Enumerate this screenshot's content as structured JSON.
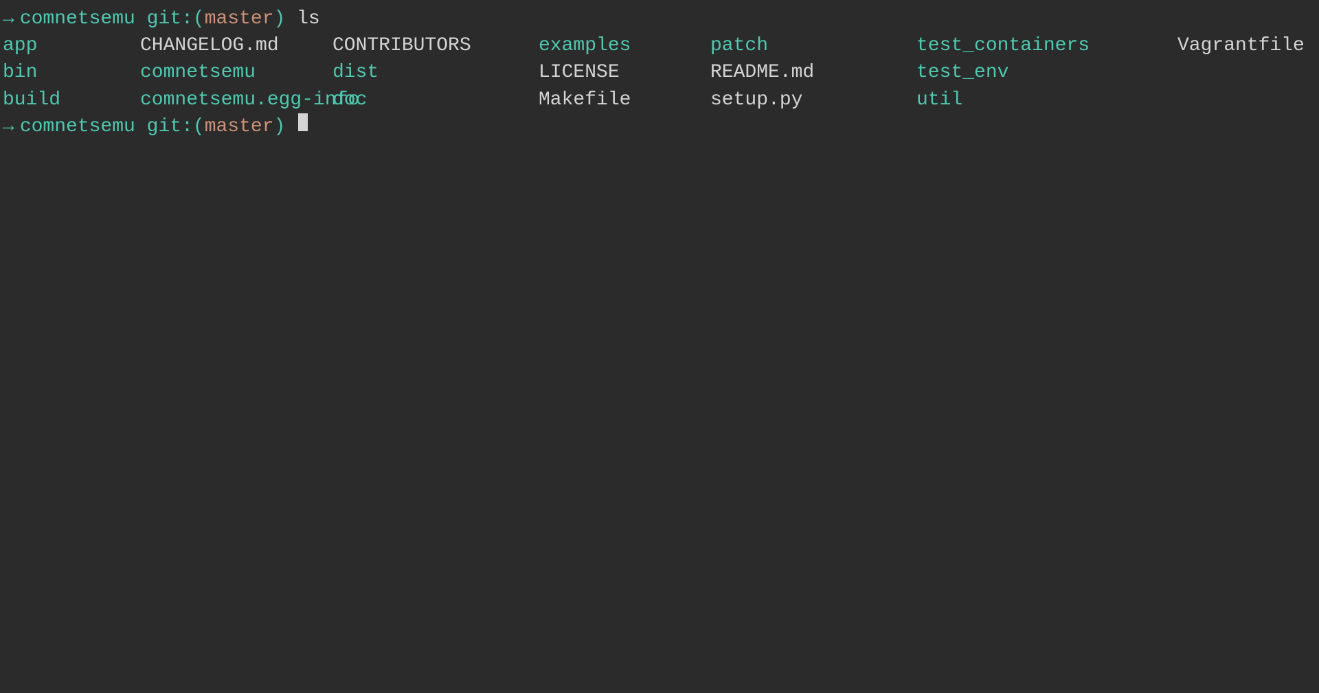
{
  "terminal": {
    "bg": "#2b2b2b",
    "prompt": {
      "arrow": "→",
      "dir": "comnetsemu",
      "git_label": "git:",
      "git_branch_open": "(",
      "git_branch": "master",
      "git_branch_close": ")",
      "cmd": "ls"
    },
    "ls_items": [
      {
        "name": "app",
        "type": "dir",
        "col": 0,
        "row": 0
      },
      {
        "name": "CHANGELOG.md",
        "type": "normal",
        "col": 1,
        "row": 0
      },
      {
        "name": "CONTRIBUTORS",
        "type": "normal",
        "col": 2,
        "row": 0
      },
      {
        "name": "examples",
        "type": "dir",
        "col": 3,
        "row": 0
      },
      {
        "name": "patch",
        "type": "dir",
        "col": 4,
        "row": 0
      },
      {
        "name": "test_containers",
        "type": "dir",
        "col": 5,
        "row": 0
      },
      {
        "name": "Vagrantfile",
        "type": "normal",
        "col": 6,
        "row": 0
      },
      {
        "name": "bin",
        "type": "dir",
        "col": 0,
        "row": 1
      },
      {
        "name": "comnetsemu",
        "type": "dir",
        "col": 1,
        "row": 1
      },
      {
        "name": "dist",
        "type": "dir",
        "col": 2,
        "row": 1
      },
      {
        "name": "LICENSE",
        "type": "normal",
        "col": 3,
        "row": 1
      },
      {
        "name": "README.md",
        "type": "normal",
        "col": 4,
        "row": 1
      },
      {
        "name": "test_env",
        "type": "dir",
        "col": 5,
        "row": 1
      },
      {
        "name": "build",
        "type": "dir",
        "col": 0,
        "row": 2
      },
      {
        "name": "comnetsemu.egg-info",
        "type": "dir",
        "col": 1,
        "row": 2
      },
      {
        "name": "doc",
        "type": "dir",
        "col": 2,
        "row": 2
      },
      {
        "name": "Makefile",
        "type": "normal",
        "col": 3,
        "row": 2
      },
      {
        "name": "setup.py",
        "type": "normal",
        "col": 4,
        "row": 2
      },
      {
        "name": "util",
        "type": "dir",
        "col": 5,
        "row": 2
      }
    ],
    "prompt2": {
      "arrow": "→",
      "dir": "comnetsemu",
      "git_label": "git:",
      "git_branch_open": "(",
      "git_branch": "master",
      "git_branch_close": ")"
    }
  }
}
